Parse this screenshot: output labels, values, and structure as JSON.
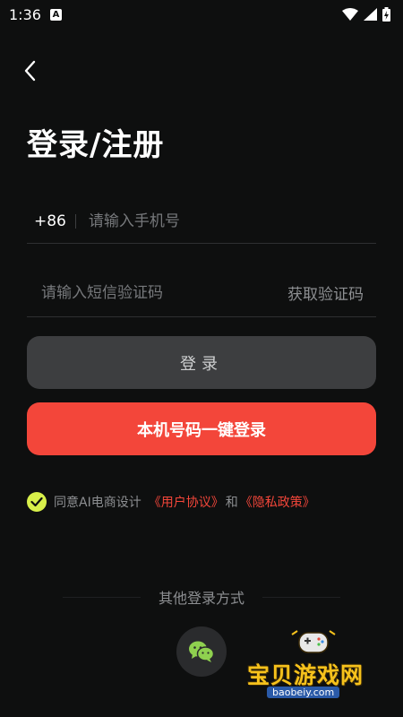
{
  "status_bar": {
    "time": "1:36",
    "notification_letter": "A"
  },
  "page": {
    "title": "登录/注册"
  },
  "phone": {
    "country_code": "+86",
    "placeholder": "请输入手机号"
  },
  "verification": {
    "placeholder": "请输入短信验证码",
    "get_code_label": "获取验证码"
  },
  "buttons": {
    "login_label": "登录",
    "one_key_label": "本机号码一键登录"
  },
  "agreement": {
    "prefix": "同意AI电商设计",
    "user_agreement": "《用户协议》",
    "and": "和",
    "privacy_policy": "《隐私政策》",
    "checked": true
  },
  "other_login": {
    "label": "其他登录方式"
  },
  "watermark": {
    "title": "宝贝游戏网",
    "url": "baobeiy.com"
  },
  "colors": {
    "background": "#0e0f0f",
    "accent_red": "#f3463a",
    "check_green": "#d8f04a",
    "button_gray": "#3d3e40"
  },
  "icons": [
    "back-arrow-icon",
    "wifi-icon",
    "signal-icon",
    "battery-icon",
    "check-icon",
    "wechat-icon"
  ]
}
